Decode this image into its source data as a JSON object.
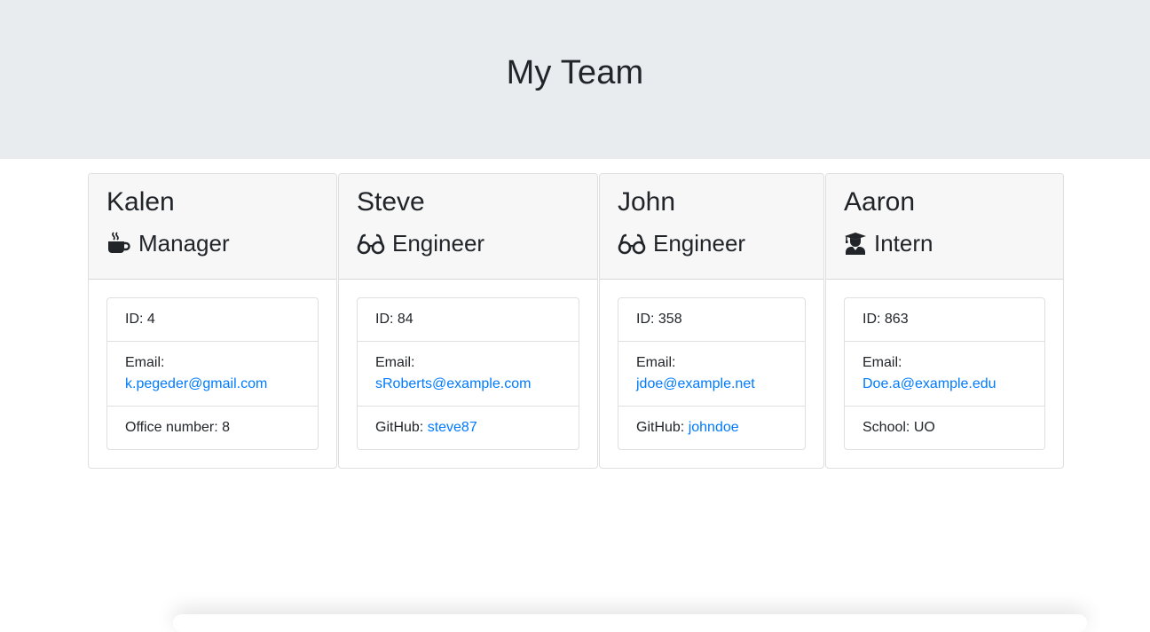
{
  "header": {
    "title": "My Team"
  },
  "colors": {
    "link": "#007bff",
    "jumbotron_bg": "#e9ecef",
    "card_header_bg": "#f7f7f7"
  },
  "employees": [
    {
      "name": "Kalen",
      "role": "Manager",
      "icon": "coffee-icon",
      "id_label": "ID: 4",
      "email_label": "Email:",
      "email": "k.pegeder@gmail.com",
      "extra_label": "Office number: 8",
      "extra_link": ""
    },
    {
      "name": "Steve",
      "role": "Engineer",
      "icon": "glasses-icon",
      "id_label": "ID: 84",
      "email_label": "Email:",
      "email": "sRoberts@example.com",
      "extra_label": "GitHub: ",
      "extra_link": "steve87"
    },
    {
      "name": "John",
      "role": "Engineer",
      "icon": "glasses-icon",
      "id_label": "ID: 358",
      "email_label": "Email:",
      "email": "jdoe@example.net",
      "extra_label": "GitHub: ",
      "extra_link": "johndoe"
    },
    {
      "name": "Aaron",
      "role": "Intern",
      "icon": "user-graduate-icon",
      "id_label": "ID: 863",
      "email_label": "Email:",
      "email": "Doe.a@example.edu",
      "extra_label": "School: UO",
      "extra_link": ""
    }
  ]
}
